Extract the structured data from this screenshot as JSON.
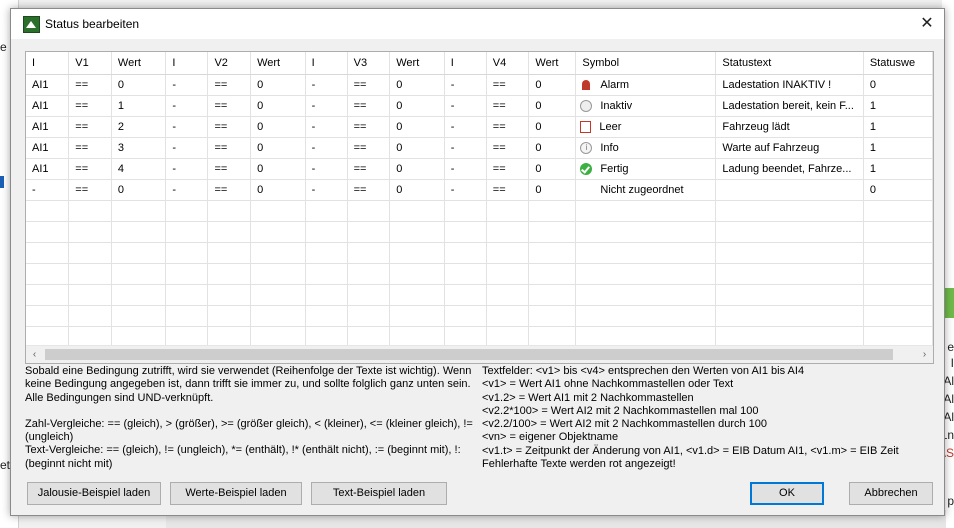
{
  "background": {
    "left_fragments": [
      "e",
      "et"
    ],
    "right_fragments": [
      "e",
      "I",
      "Al",
      "Al",
      "Al",
      "Ln",
      "AS",
      "p"
    ]
  },
  "dialog": {
    "title": "Status bearbeiten",
    "close_icon": "close-icon"
  },
  "table": {
    "columns": [
      "I",
      "V1",
      "Wert",
      "I",
      "V2",
      "Wert",
      "I",
      "V3",
      "Wert",
      "I",
      "V4",
      "Wert",
      "Symbol",
      "Statustext",
      "Statuswe"
    ],
    "rows": [
      {
        "i1": "AI1",
        "v1": "==",
        "w1": "0",
        "i2": "-",
        "v2": "==",
        "w2": "0",
        "i3": "-",
        "v3": "==",
        "w3": "0",
        "i4": "-",
        "v4": "==",
        "w4": "0",
        "icon": "alarm-icon",
        "symbol": "Alarm",
        "statustext": "Ladestation INAKTIV !",
        "statuswert": "0"
      },
      {
        "i1": "AI1",
        "v1": "==",
        "w1": "1",
        "i2": "-",
        "v2": "==",
        "w2": "0",
        "i3": "-",
        "v3": "==",
        "w3": "0",
        "i4": "-",
        "v4": "==",
        "w4": "0",
        "icon": "inaktiv-icon",
        "symbol": "Inaktiv",
        "statustext": "Ladestation bereit, kein F...",
        "statuswert": "1"
      },
      {
        "i1": "AI1",
        "v1": "==",
        "w1": "2",
        "i2": "-",
        "v2": "==",
        "w2": "0",
        "i3": "-",
        "v3": "==",
        "w3": "0",
        "i4": "-",
        "v4": "==",
        "w4": "0",
        "icon": "leer-icon",
        "symbol": "Leer",
        "statustext": "Fahrzeug lädt",
        "statuswert": "1"
      },
      {
        "i1": "AI1",
        "v1": "==",
        "w1": "3",
        "i2": "-",
        "v2": "==",
        "w2": "0",
        "i3": "-",
        "v3": "==",
        "w3": "0",
        "i4": "-",
        "v4": "==",
        "w4": "0",
        "icon": "info-icon",
        "symbol": "Info",
        "statustext": "Warte auf Fahrzeug",
        "statuswert": "1"
      },
      {
        "i1": "AI1",
        "v1": "==",
        "w1": "4",
        "i2": "-",
        "v2": "==",
        "w2": "0",
        "i3": "-",
        "v3": "==",
        "w3": "0",
        "i4": "-",
        "v4": "==",
        "w4": "0",
        "icon": "fertig-icon",
        "symbol": "Fertig",
        "statustext": "Ladung beendet, Fahrze...",
        "statuswert": "1"
      },
      {
        "i1": "-",
        "v1": "==",
        "w1": "0",
        "i2": "-",
        "v2": "==",
        "w2": "0",
        "i3": "-",
        "v3": "==",
        "w3": "0",
        "i4": "-",
        "v4": "==",
        "w4": "0",
        "icon": "none",
        "symbol": "Nicht zugeordnet",
        "statustext": "",
        "statuswert": "0"
      }
    ],
    "empty_rows": 7
  },
  "help_left": [
    "Sobald eine Bedingung zutrifft, wird sie verwendet (Reihenfolge der Texte ist wichtig). Wenn keine Bedingung angegeben ist, dann trifft sie immer zu, und sollte folglich ganz unten sein. Alle Bedingungen sind UND-verknüpft.",
    "",
    "Zahl-Vergleiche: == (gleich), > (größer), >= (größer gleich), < (kleiner), <= (kleiner gleich), != (ungleich)",
    "Text-Vergleiche: == (gleich), != (ungleich), *= (enthält), !* (enthält nicht), := (beginnt mit), !: (beginnt nicht mit)"
  ],
  "help_right": [
    "Textfelder: <v1> bis <v4> entsprechen den Werten von AI1 bis AI4",
    "<v1> = Wert AI1 ohne Nachkommastellen oder Text",
    "<v1.2> = Wert AI1 mit 2 Nachkommastellen",
    "<v2.2*100> = Wert AI2 mit 2 Nachkommastellen mal 100",
    "<v2.2/100> = Wert AI2 mit 2 Nachkommastellen durch 100",
    "<vn> = eigener Objektname",
    "<v1.t> = Zeitpunkt der Änderung von AI1, <v1.d> = EIB Datum AI1, <v1.m> = EIB Zeit",
    "Fehlerhafte Texte werden rot angezeigt!"
  ],
  "buttons": {
    "jalousie": "Jalousie-Beispiel laden",
    "werte": "Werte-Beispiel laden",
    "text": "Text-Beispiel laden",
    "ok": "OK",
    "abbrechen": "Abbrechen"
  },
  "scrollbar": {
    "left_arrow": "‹",
    "right_arrow": "›"
  }
}
